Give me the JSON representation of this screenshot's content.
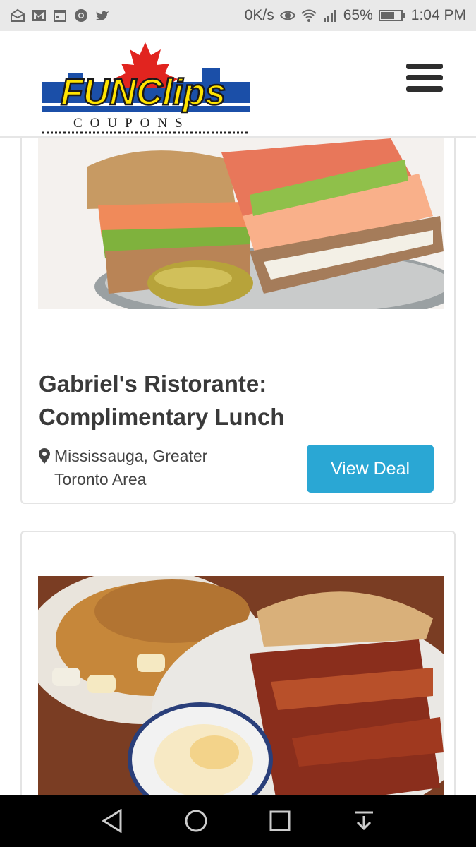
{
  "status_bar": {
    "speed": "0K/s",
    "battery": "65%",
    "time": "1:04 PM",
    "icons": [
      "mail-open-icon",
      "gmail-icon",
      "calendar-icon",
      "chrome-icon",
      "twitter-icon",
      "eye-icon",
      "wifi-icon",
      "signal-icon",
      "battery-icon"
    ]
  },
  "header": {
    "logo": {
      "brand": "FUN Clips",
      "sub": "COUPONS"
    },
    "menu_icon": "hamburger-menu-icon"
  },
  "deals": [
    {
      "image": "club-sandwich-photo",
      "title": "Gabriel's Ristorante:\nComplimentary Lunch",
      "location": "Mississauga, Greater\nToronto Area",
      "button": "View Deal"
    },
    {
      "image": "breakfast-plate-photo"
    }
  ],
  "nav_bar": {
    "icons": [
      "back-icon",
      "home-icon",
      "recents-icon",
      "notifications-pull-icon"
    ]
  },
  "colors": {
    "accent": "#2aa7d4",
    "title": "#3a3a3a",
    "nav": "#000000"
  }
}
